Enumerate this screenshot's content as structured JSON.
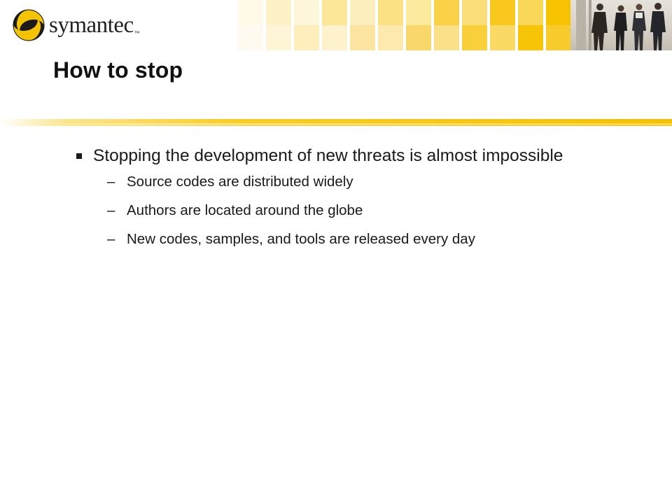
{
  "header": {
    "logo": {
      "name": "symantec",
      "trademark": "™"
    },
    "banner": {
      "palette": [
        "#f7c200",
        "#f9d54a",
        "#fbe38a",
        "#fdefc0",
        "#fef7df"
      ],
      "photo_icon": "business-people-photo"
    }
  },
  "slide": {
    "title": "How to stop",
    "bullets": [
      {
        "text": "Stopping the development of new threats is almost impossible",
        "sub": [
          "Source codes are distributed widely",
          "Authors are located around the globe",
          "New codes, samples, and tools are released every day"
        ]
      }
    ]
  },
  "theme": {
    "accent": "#f6c100",
    "text": "#1a1a1a"
  }
}
